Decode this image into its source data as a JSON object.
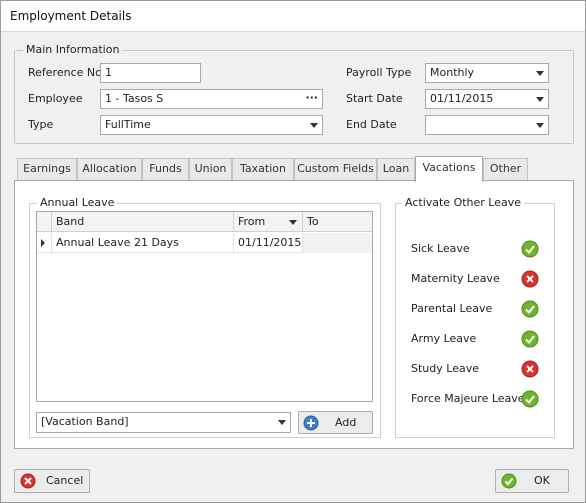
{
  "window": {
    "title": "Employment Details"
  },
  "main_info": {
    "legend": "Main Information",
    "reference_no": {
      "label": "Reference No",
      "value": "1"
    },
    "employee": {
      "label": "Employee",
      "value": "1 - Tasos S",
      "button": "···"
    },
    "type": {
      "label": "Type",
      "value": "FullTime"
    },
    "payroll_type": {
      "label": "Payroll Type",
      "value": "Monthly"
    },
    "start_date": {
      "label": "Start Date",
      "value": "01/11/2015"
    },
    "end_date": {
      "label": "End Date",
      "value": ""
    }
  },
  "tabs": [
    {
      "label": "Earnings",
      "active": false
    },
    {
      "label": "Allocation",
      "active": false
    },
    {
      "label": "Funds",
      "active": false
    },
    {
      "label": "Union",
      "active": false
    },
    {
      "label": "Taxation",
      "active": false
    },
    {
      "label": "Custom Fields",
      "active": false
    },
    {
      "label": "Loan",
      "active": false
    },
    {
      "label": "Vacations",
      "active": true
    },
    {
      "label": "Other",
      "active": false
    }
  ],
  "annual_leave": {
    "legend": "Annual Leave",
    "columns": [
      "Band",
      "From",
      "To"
    ],
    "rows": [
      {
        "band": "Annual Leave 21 Days",
        "from": "01/11/2015",
        "to": ""
      }
    ],
    "band_select": {
      "value": "[Vacation Band]"
    },
    "add_button": "Add"
  },
  "other_leave": {
    "legend": "Activate Other Leave",
    "items": [
      {
        "label": "Sick Leave",
        "status": "check-icon",
        "active": true
      },
      {
        "label": "Maternity Leave",
        "status": "cross-icon",
        "active": false
      },
      {
        "label": "Parental Leave",
        "status": "check-icon",
        "active": true
      },
      {
        "label": "Army Leave",
        "status": "check-icon",
        "active": true
      },
      {
        "label": "Study Leave",
        "status": "cross-icon",
        "active": false
      },
      {
        "label": "Force Majeure Leave",
        "status": "check-icon",
        "active": true
      }
    ]
  },
  "footer": {
    "cancel": "Cancel",
    "ok": "OK"
  },
  "colors": {
    "check_green": "#6fb52c",
    "cross_red": "#d9342b",
    "add_blue": "#3a7fd0"
  }
}
